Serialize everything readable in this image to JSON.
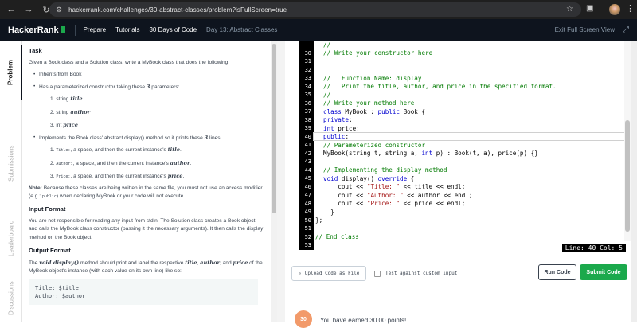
{
  "browser": {
    "url": "hackerrank.com/challenges/30-abstract-classes/problem?isFullScreen=true"
  },
  "header": {
    "logo": "HackerRank",
    "nav": [
      "Prepare",
      "Tutorials",
      "30 Days of Code",
      "Day 13: Abstract Classes"
    ],
    "exit_fullscreen": "Exit Full Screen View"
  },
  "left_tabs": [
    "Problem",
    "Submissions",
    "Leaderboard",
    "Discussions"
  ],
  "problem": {
    "task_heading": "Task",
    "intro": "Given a Book class and a Solution class, write a MyBook class that does the following:",
    "bullet1": "Inherits from Book",
    "bullet2_pre": "Has a parameterized constructor taking these ",
    "bullet2_num": "3",
    "bullet2_post": " parameters:",
    "params": [
      {
        "type": "string",
        "name": "title"
      },
      {
        "type": "string",
        "name": "author"
      },
      {
        "type": "int",
        "name": "price"
      }
    ],
    "bullet3_pre": "Implements the Book class' abstract display() method so it prints these ",
    "bullet3_num": "3",
    "bullet3_post": " lines:",
    "lines": [
      {
        "code": "Title:",
        "text": ", a space, and then the current instance's ",
        "var": "title"
      },
      {
        "code": "Author:",
        "text": ", a space, and then the current instance's ",
        "var": "author"
      },
      {
        "code": "Price:",
        "text": ", a space, and then the current instance's ",
        "var": "price"
      }
    ],
    "note_label": "Note:",
    "note_text1": " Because these classes are being written in the same file, you must not use an access modifier (e.g.: ",
    "note_code": "public",
    "note_text2": ") when declaring MyBook or your code will not execute.",
    "input_heading": "Input Format",
    "input_text": "You are not responsible for reading any input from stdin. The Solution class creates a Book object and calls the MyBook class constructor (passing it the necessary arguments). It then calls the display method on the Book object.",
    "output_heading": "Output Format",
    "output_pre": "The ",
    "output_method": "void display()",
    "output_mid": " method should print and label the respective ",
    "output_v1": "title",
    "output_c1": ", ",
    "output_v2": "author",
    "output_c2": ", and",
    "output_v3": "price",
    "output_post": " of the MyBook object's instance (with each value on its own line) like so:",
    "sample": [
      "Title: $title",
      "Author: $author"
    ]
  },
  "editor": {
    "lines": [
      {
        "n": "",
        "html": "<span class='cm'>//</span>"
      },
      {
        "n": "30",
        "html": "<span class='cm'>// Write your constructor here</span>"
      },
      {
        "n": "31",
        "html": ""
      },
      {
        "n": "32",
        "html": ""
      },
      {
        "n": "33",
        "html": "<span class='cm'>//   Function Name: display</span>"
      },
      {
        "n": "34",
        "html": "<span class='cm'>//   Print the title, author, and price in the specified format.</span>"
      },
      {
        "n": "35",
        "html": "<span class='cm'>//</span>"
      },
      {
        "n": "36",
        "html": "<span class='cm'>// Write your method here</span>"
      },
      {
        "n": "37",
        "html": "<span class='kw'>class</span> MyBook : <span class='kw'>public</span> Book {"
      },
      {
        "n": "38",
        "html": "<span class='kw'>private</span>:"
      },
      {
        "n": "39",
        "html": "<span class='kw'>int</span> price;"
      },
      {
        "n": "40",
        "html": "<span class='kw'>public</span>:",
        "active": true
      },
      {
        "n": "41",
        "html": "<span class='cm'>// Parameterized constructor</span>"
      },
      {
        "n": "42",
        "html": "MyBook(string t, string a, <span class='kw'>int</span> p) : Book(t, a), price(p) {}"
      },
      {
        "n": "43",
        "html": ""
      },
      {
        "n": "44",
        "html": "<span class='cm'>// Implementing the display method</span>"
      },
      {
        "n": "45",
        "html": "<span class='kw'>void</span> display() <span class='kw'>override</span> {"
      },
      {
        "n": "46",
        "html": "    cout &lt;&lt; <span class='st'>\"Title: \"</span> &lt;&lt; title &lt;&lt; endl;"
      },
      {
        "n": "47",
        "html": "    cout &lt;&lt; <span class='st'>\"Author: \"</span> &lt;&lt; author &lt;&lt; endl;"
      },
      {
        "n": "48",
        "html": "    cout &lt;&lt; <span class='st'>\"Price: \"</span> &lt;&lt; price &lt;&lt; endl;"
      },
      {
        "n": "49",
        "html": "  }"
      },
      {
        "n": "50",
        "html": "};",
        "outdent": true
      },
      {
        "n": "51",
        "html": ""
      },
      {
        "n": "52",
        "html": "<span class='cm'>// End class</span>",
        "outdent": true
      },
      {
        "n": "53",
        "html": ""
      }
    ],
    "status": "Line: 40 Col: 5"
  },
  "actions": {
    "upload": "Upload Code as File",
    "custom_input": "Test against custom input",
    "run": "Run Code",
    "submit": "Submit Code"
  },
  "bottom": {
    "badge": "30",
    "text": "You have earned 30.00 points!"
  }
}
